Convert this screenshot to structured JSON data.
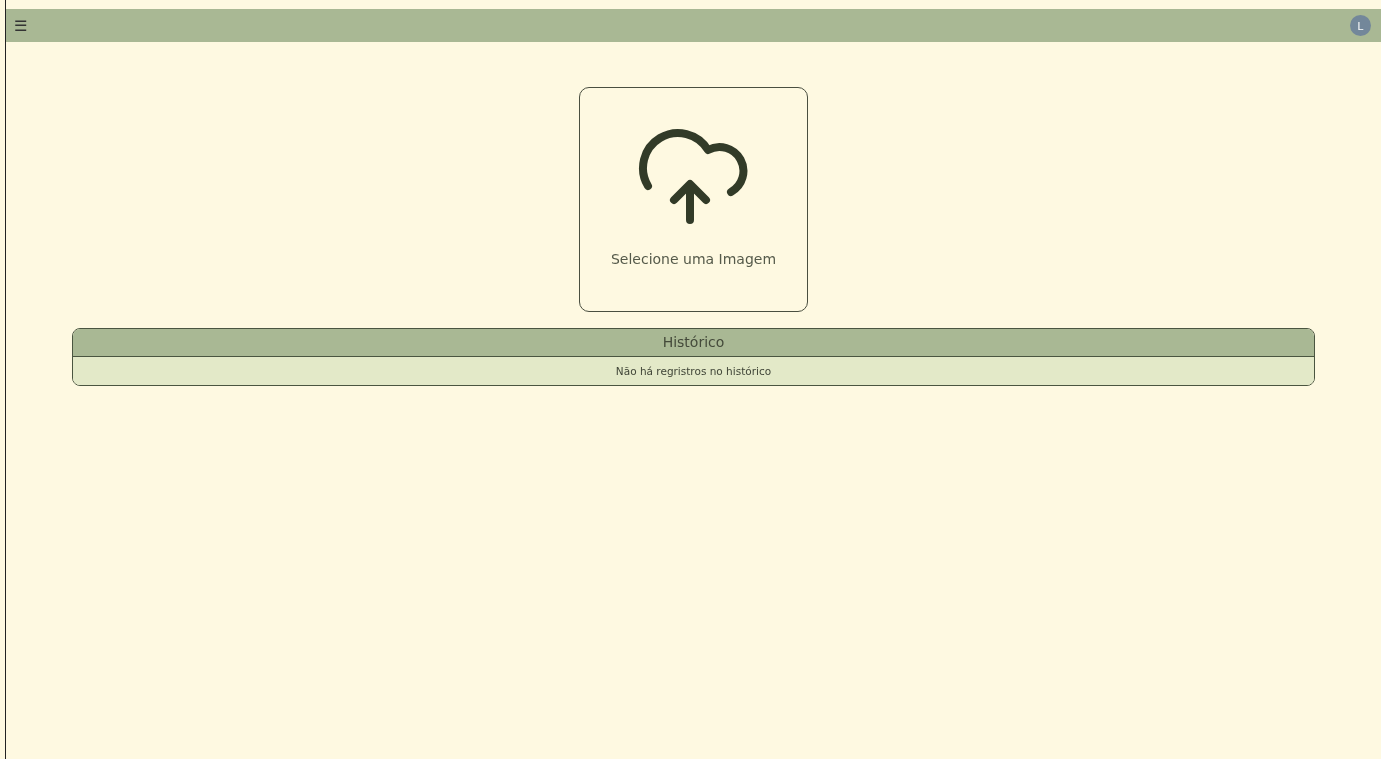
{
  "header": {
    "menu_icon": "☰",
    "avatar_initial": "L"
  },
  "upload": {
    "label": "Selecione uma Imagem"
  },
  "history": {
    "title": "Histórico",
    "empty_message": "Não há regristros no histórico"
  }
}
